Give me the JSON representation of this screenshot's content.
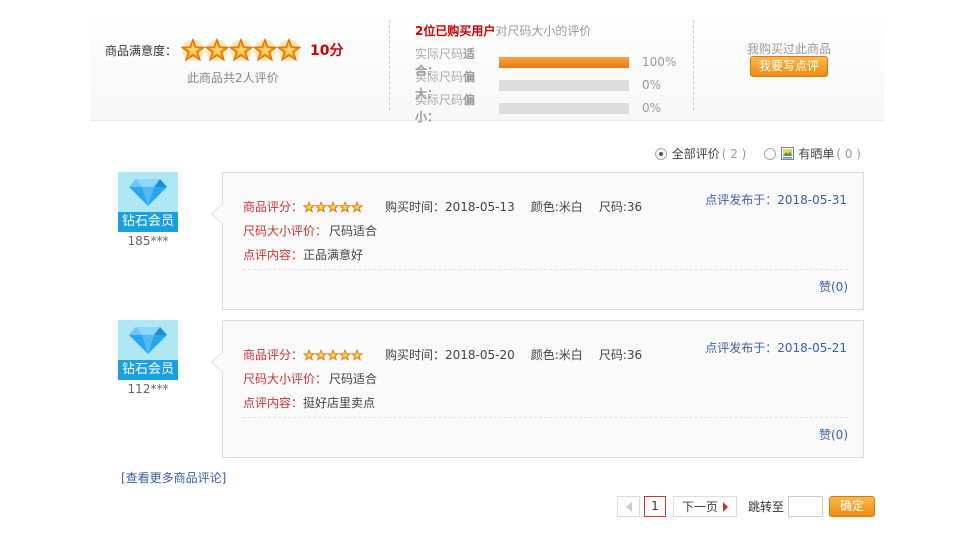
{
  "summary": {
    "satisfaction_label": "商品满意度：",
    "star_rating": 5,
    "star_max": 5,
    "score": "10分",
    "total_text": "此商品共2人评价",
    "size_title_highlight": "2位已购买用户",
    "size_title_rest": "对尺码大小的评价",
    "size_rows": [
      {
        "label_prefix": "实际尺码",
        "label_bold": "适合：",
        "percent": 100,
        "percent_text": "100%"
      },
      {
        "label_prefix": "实际尺码",
        "label_bold": "偏大：",
        "percent": 0,
        "percent_text": "0%"
      },
      {
        "label_prefix": "实际尺码",
        "label_bold": "偏小：",
        "percent": 0,
        "percent_text": "0%"
      }
    ],
    "bought_text": "我购买过此商品",
    "write_button": "我要写点评"
  },
  "filter": {
    "all_label": "全部评价",
    "all_count": "( 2 )",
    "photo_label": "有晒单",
    "photo_count": "( 0 )"
  },
  "reviews": [
    {
      "member_badge": "钻石会员",
      "username": "185***",
      "rating_label": "商品评分：",
      "stars": 5,
      "purchase_time": "购买时间：2018-05-13",
      "color": "颜色:米白",
      "size": "尺码:36",
      "size_eval_label": "尺码大小评价：",
      "size_eval_value": "尺码适合",
      "content_label": "点评内容：",
      "content_value": "正品满意好",
      "posted": "点评发布于：2018-05-31",
      "likes": "赞(0)"
    },
    {
      "member_badge": "钻石会员",
      "username": "112***",
      "rating_label": "商品评分：",
      "stars": 5,
      "purchase_time": "购买时间：2018-05-20",
      "color": "颜色:米白",
      "size": "尺码:36",
      "size_eval_label": "尺码大小评价：",
      "size_eval_value": "尺码适合",
      "content_label": "点评内容：",
      "content_value": "挺好店里卖点",
      "posted": "点评发布于：2018-05-21",
      "likes": "赞(0)"
    }
  ],
  "more_link": "[查看更多商品评论]",
  "pagination": {
    "current_page": "1",
    "next_label": "下一页",
    "jump_label": "跳转至",
    "jump_value": "",
    "confirm_label": "确定"
  },
  "colors": {
    "accent_red": "#cc0000",
    "link_blue": "#3a5fa8",
    "button_orange": "#ee8c11",
    "member_blue": "#1a9fe0"
  }
}
